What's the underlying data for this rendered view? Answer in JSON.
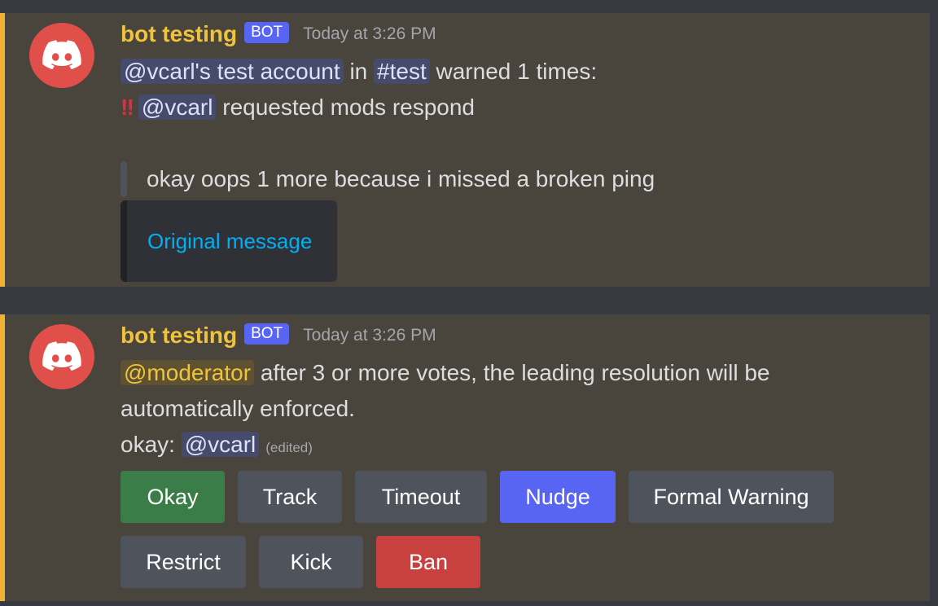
{
  "colors": {
    "background": "#36393f",
    "message_highlight": "#49443c",
    "highlight_border": "#f0b232",
    "username": "#f0c33c",
    "bot_tag": "#5865f2",
    "avatar": "#e04f4a",
    "link": "#00aff4",
    "button_success": "#3b7d49",
    "button_secondary": "#4f545c",
    "button_primary": "#5865f2",
    "button_danger": "#c9413f"
  },
  "messages": [
    {
      "author": "bot testing",
      "bot_tag": "BOT",
      "timestamp": "Today at 3:26 PM",
      "avatar_icon": "discord-logo-icon",
      "line1": {
        "user_mention": "@vcarl's test account",
        "in": "in",
        "channel_mention": "#test",
        "suffix": "warned 1 times:"
      },
      "line2": {
        "emoji": "‼",
        "emoji_icon": "double-exclamation-icon",
        "user_mention": "@vcarl",
        "suffix": "requested mods respond"
      },
      "quote": "okay oops 1 more because i missed a broken ping",
      "embed_link": "Original message"
    },
    {
      "author": "bot testing",
      "bot_tag": "BOT",
      "timestamp": "Today at 3:26 PM",
      "avatar_icon": "discord-logo-icon",
      "role_mention": "@moderator",
      "text1": "after 3 or more votes, the leading resolution will be",
      "text2": "automatically enforced.",
      "okay_prefix": "okay:",
      "okay_mention": "@vcarl",
      "edited": "(edited)",
      "buttons": {
        "okay": "Okay",
        "track": "Track",
        "timeout": "Timeout",
        "nudge": "Nudge",
        "formal_warning": "Formal Warning",
        "restrict": "Restrict",
        "kick": "Kick",
        "ban": "Ban"
      }
    }
  ]
}
